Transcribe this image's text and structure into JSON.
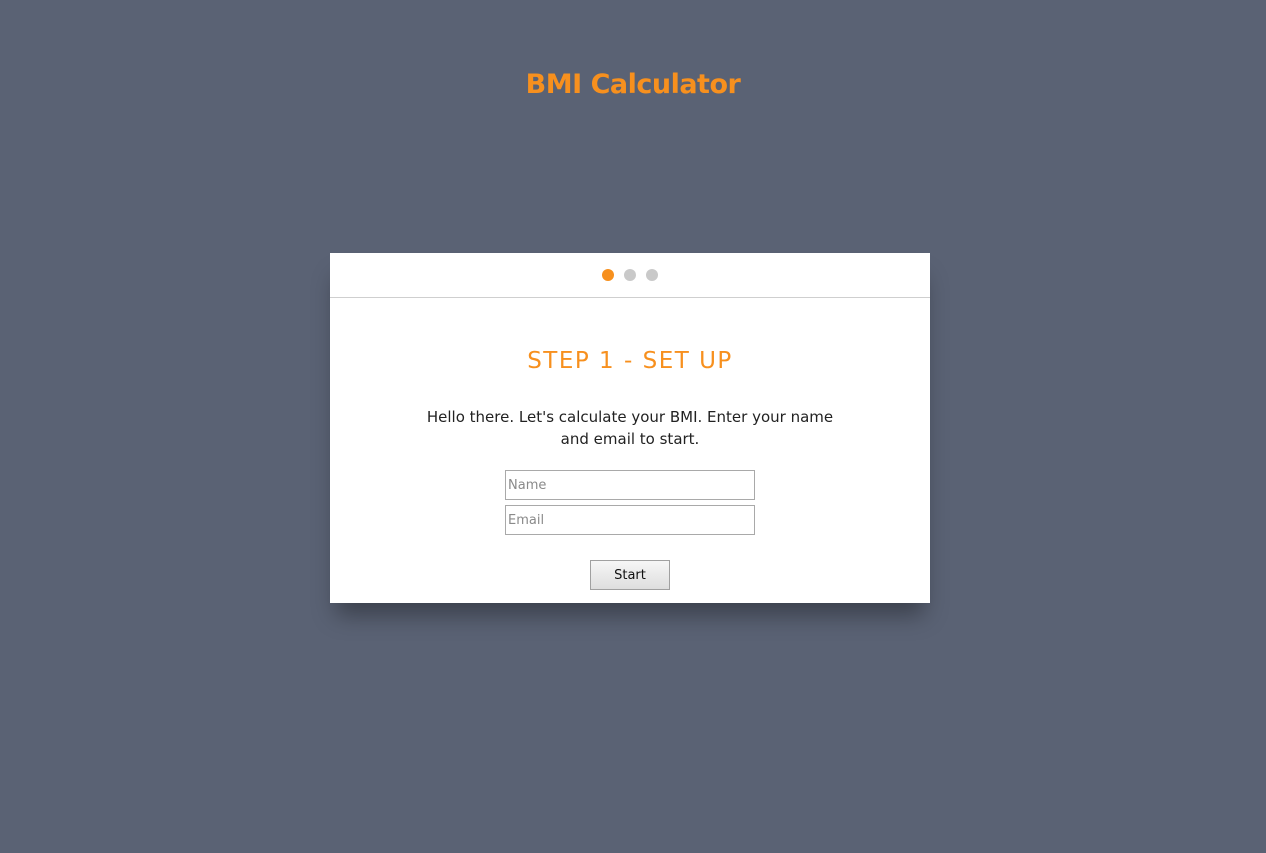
{
  "app": {
    "title": "BMI Calculator",
    "accent_color": "#f7901e",
    "background_color": "#5a6274"
  },
  "stepper": {
    "total_steps": 3,
    "active_step": 1
  },
  "step": {
    "title": "STEP 1 - SET UP",
    "intro": "Hello there. Let's calculate your BMI. Enter your name and email to start."
  },
  "form": {
    "name": {
      "value": "",
      "placeholder": "Name"
    },
    "email": {
      "value": "",
      "placeholder": "Email"
    },
    "start_label": "Start"
  }
}
